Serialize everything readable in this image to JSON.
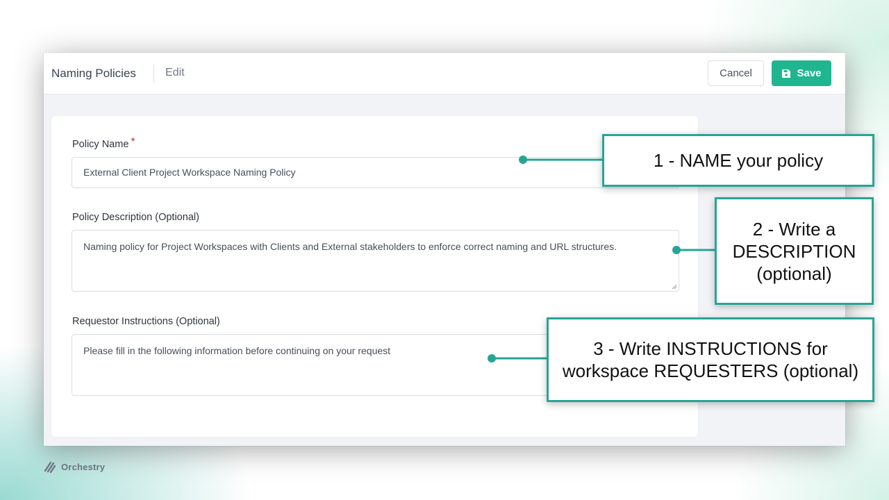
{
  "header": {
    "title": "Naming Policies",
    "subtitle": "Edit",
    "cancel_label": "Cancel",
    "save_label": "Save"
  },
  "form": {
    "policy_name": {
      "label": "Policy Name",
      "required_marker": "*",
      "value": "External Client Project Workspace Naming Policy"
    },
    "policy_description": {
      "label": "Policy Description (Optional)",
      "value": "Naming policy for Project Workspaces with Clients and External stakeholders to enforce correct naming and URL structures."
    },
    "requestor_instructions": {
      "label": "Requestor Instructions (Optional)",
      "value": "Please fill in the following information before continuing on your request"
    }
  },
  "callouts": {
    "name": "1 - NAME your policy",
    "description_line1": "2 - Write a",
    "description_line2": "DESCRIPTION",
    "description_line3": "(optional)",
    "instructions_line1": "3 - Write INSTRUCTIONS for",
    "instructions_line2": "workspace REQUESTERS (optional)"
  },
  "brand": {
    "name": "Orchestry"
  },
  "colors": {
    "accent": "#1fb58f",
    "callout_border": "#26a595",
    "required": "#d0342c"
  }
}
